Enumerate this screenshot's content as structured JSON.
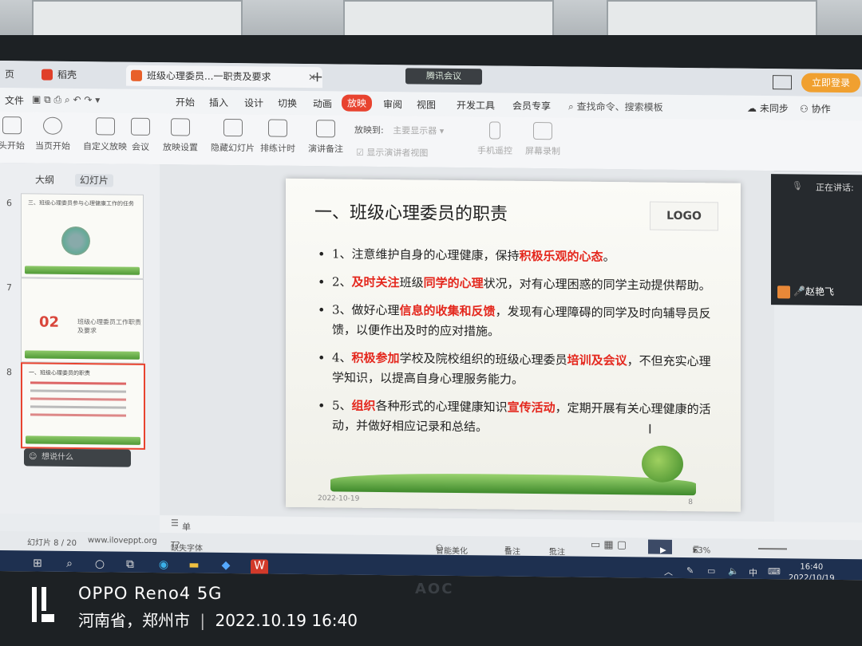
{
  "browser": {
    "tabs": [
      {
        "label": "页"
      },
      {
        "label": "稻壳"
      },
      {
        "label": "班级心理委员...一职责及要求"
      }
    ],
    "meeting_label": "腾讯会议",
    "login_label": "立即登录"
  },
  "ribbon": {
    "menus": [
      "文件",
      "开始",
      "插入",
      "设计",
      "切换",
      "动画",
      "放映",
      "审阅",
      "视图",
      "开发工具",
      "会员专享"
    ],
    "active_menu": "放映",
    "search_placeholder": "查找命令、搜索模板",
    "sync_label": "未同步",
    "collab_label": "协作",
    "tools": [
      "头开始",
      "当页开始",
      "自定义放映",
      "会议",
      "放映设置",
      "隐藏幻灯片",
      "排练计时",
      "演讲备注"
    ],
    "play_to_label": "放映到:",
    "play_to_value": "主要显示器",
    "presenter_view_label": "显示演讲者视图",
    "phone_remote_label": "手机遥控",
    "screen_record_label": "屏幕录制"
  },
  "sidebar": {
    "tabs": [
      "大纲",
      "幻灯片"
    ],
    "active_tab": "幻灯片",
    "thumbs": [
      {
        "num": "6",
        "title": "三、班级心理委员参与心理健康工作的任务"
      },
      {
        "num": "7",
        "big": "02",
        "title": "班级心理委员工作职责及要求"
      },
      {
        "num": "8",
        "title": "一、班级心理委员的职责"
      }
    ],
    "popup_text": "想说什么"
  },
  "slide": {
    "title": "一、班级心理委员的职责",
    "logo": "LOGO",
    "bullets": [
      {
        "segments": [
          {
            "t": "1、注意维护自身的心理健康，保持"
          },
          {
            "t": "积极乐观的心态",
            "red": true
          },
          {
            "t": "。"
          }
        ]
      },
      {
        "segments": [
          {
            "t": "2、"
          },
          {
            "t": "及时关注",
            "red": true
          },
          {
            "t": "班级"
          },
          {
            "t": "同学的心理",
            "red": true
          },
          {
            "t": "状况，对有心理困惑的同学主动提供帮助。"
          }
        ]
      },
      {
        "segments": [
          {
            "t": "3、做好心理"
          },
          {
            "t": "信息的收集和反馈",
            "red": true
          },
          {
            "t": "，发现有心理障碍的同学及时向辅导员反馈，以便作出及时的应对措施。"
          }
        ]
      },
      {
        "segments": [
          {
            "t": "4、"
          },
          {
            "t": "积极参加",
            "red": true
          },
          {
            "t": "学校及院校组织的班级心理委员"
          },
          {
            "t": "培训及会议",
            "red": true
          },
          {
            "t": "，不但充实心理学知识，以提高自身心理服务能力。"
          }
        ]
      },
      {
        "segments": [
          {
            "t": "5、"
          },
          {
            "t": "组织",
            "red": true
          },
          {
            "t": "各种形式的心理健康知识"
          },
          {
            "t": "宣传活动",
            "red": true
          },
          {
            "t": "，定期开展有关心理健康的活动，并做好相应记录和总结。"
          }
        ]
      }
    ],
    "footer_date": "2022-10-19",
    "page_num": "8"
  },
  "speaker": {
    "label": "正在讲话:",
    "name": "赵艳飞"
  },
  "notes": {
    "placeholder": "单击此处添加备注"
  },
  "status": {
    "slide_count": "幻灯片 8 / 20",
    "site": "www.iloveppt.org",
    "missing_font": "缺失字体",
    "beautify": "智能美化",
    "notes_label": "备注",
    "comment_label": "批注",
    "zoom": "63%"
  },
  "taskbar": {
    "ime": "中",
    "time": "16:40",
    "date": "2022/10/19"
  },
  "monitor_brand": "AOC",
  "watermark": {
    "device": "OPPO Reno4 5G",
    "location": "河南省，郑州市",
    "datetime": "2022.10.19 16:40"
  },
  "colors": {
    "accent_red": "#e4281e",
    "login_orange": "#f0a030",
    "taskbar": "#1e3050"
  }
}
